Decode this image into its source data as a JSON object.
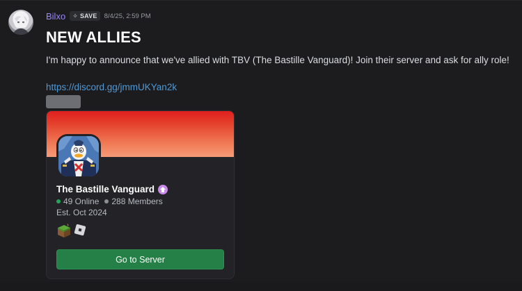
{
  "message": {
    "author": "Bilxo",
    "tag": {
      "icon": "sparkle-icon",
      "label": "SAVE"
    },
    "timestamp": "8/4/25, 2:59 PM",
    "title": "NEW ALLIES",
    "body": "I'm happy to announce that we've allied with TBV (The Bastille Vanguard)! Join their server and ask for ally role!",
    "link": "https://discord.gg/jmmUKYan2k"
  },
  "invite": {
    "server_name": "The Bastille Vanguard",
    "online": "49 Online",
    "members": "288 Members",
    "established": "Est. Oct 2024",
    "button_label": "Go to Server",
    "game_icons": [
      "minecraft-icon",
      "roblox-icon"
    ]
  },
  "colors": {
    "username": "#9b87f5",
    "link": "#4f9ad8",
    "button": "#248046",
    "online": "#23a55a",
    "banner_top": "#e01f1f",
    "banner_bottom": "#f79b78"
  }
}
